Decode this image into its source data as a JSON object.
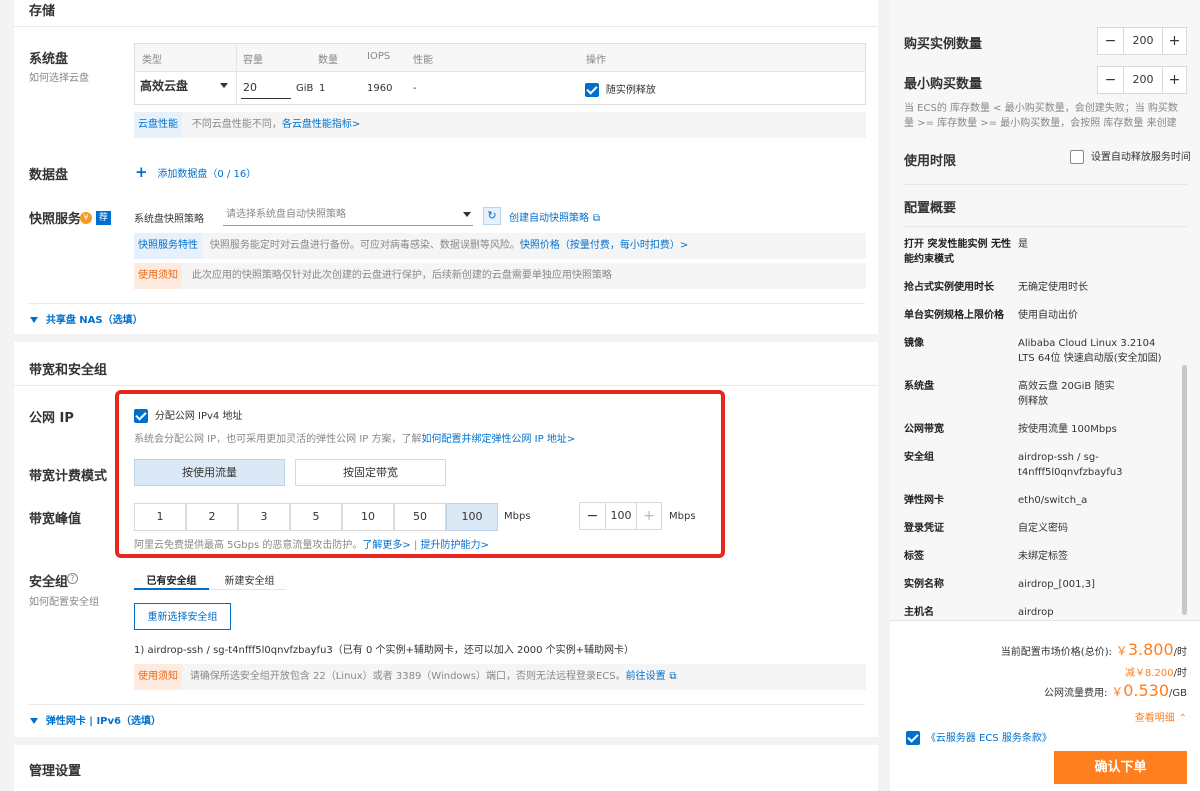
{
  "storage": {
    "section_title": "存储",
    "system_disk_label": "系统盘",
    "system_disk_help": "如何选择云盘",
    "table_headers": [
      "类型",
      "容量",
      "数量",
      "IOPS",
      "性能",
      "操作"
    ],
    "disk_type": "高效云盘",
    "capacity_value": "20",
    "capacity_unit": "GiB",
    "quantity": "1",
    "iops": "1960",
    "performance": "-",
    "release_with_instance": "随实例释放",
    "perf_tag": "云盘性能",
    "perf_text": "不同云盘性能不同，",
    "perf_link": "各云盘性能指标>",
    "data_disk_label": "数据盘",
    "add_data_disk": "添加数据盘（0 / 16）",
    "snapshot_label": "快照服务",
    "snapshot_badge": "荐",
    "snapshot_policy_label": "系统盘快照策略",
    "snapshot_policy_placeholder": "请选择系统盘自动快照策略",
    "create_snapshot_policy": "创建自动快照策略",
    "snapshot_feature_tag": "快照服务特性",
    "snapshot_feature_text": "快照服务能定时对云盘进行备份。可应对病毒感染、数据误删等风险。",
    "snapshot_price_link": "快照价格（按量付费，每小时扣费）>",
    "usage_notice_tag": "使用须知",
    "snapshot_notice_text": "此次应用的快照策略仅针对此次创建的云盘进行保护，后续新创建的云盘需要单独应用快照策略",
    "nas_toggle": "共享盘 NAS（选填）"
  },
  "network": {
    "section_title": "带宽和安全组",
    "public_ip_label": "公网 IP",
    "assign_ipv4": "分配公网 IPv4 地址",
    "ip_desc": "系统会分配公网 IP，也可采用更加灵活的弹性公网 IP 方案，了解",
    "ip_link": "如何配置并绑定弹性公网 IP 地址>",
    "billing_label": "带宽计费模式",
    "billing_options": [
      "按使用流量",
      "按固定带宽"
    ],
    "billing_selected": "按使用流量",
    "peak_label": "带宽峰值",
    "bandwidth_options": [
      "1",
      "2",
      "3",
      "5",
      "10",
      "50",
      "100"
    ],
    "bandwidth_selected": "100",
    "unit": "Mbps",
    "bandwidth_stepper_value": "100",
    "ddos_text": "阿里云免费提供最高 5Gbps 的恶意流量攻击防护。",
    "learn_more": "了解更多>",
    "separator": "|",
    "improve_protection": "提升防护能力>",
    "sg_label": "安全组",
    "sg_help": "如何配置安全组",
    "sg_tabs": [
      "已有安全组",
      "新建安全组"
    ],
    "reselect_sg": "重新选择安全组",
    "sg_line": "1) airdrop-ssh / sg-t4nfff5l0qnvfzbayfu3（已有 0 个实例+辅助网卡，还可以加入 2000 个实例+辅助网卡）",
    "sg_notice_tag": "使用须知",
    "sg_notice_text": "请确保所选安全组开放包含 22（Linux）或者 3389（Windows）端口，否则无法远程登录ECS。",
    "goto_settings": "前往设置",
    "eni_toggle": "弹性网卡 | IPv6（选填）"
  },
  "management": {
    "section_title": "管理设置"
  },
  "sidebar": {
    "buy_count_label": "购买实例数量",
    "buy_count_value": "200",
    "min_buy_label": "最小购买数量",
    "min_buy_value": "200",
    "stock_note": "当 ECS的 库存数量 < 最小购买数量，会创建失败；当 购买数量 >= 库存数量 >= 最小购买数量，会按照 库存数量 来创建",
    "duration_label": "使用时限",
    "auto_release": "设置自动释放服务时间",
    "summary_title": "配置概要",
    "summary": [
      {
        "k": "打开 突发性能实例 无性能约束模式",
        "v": "是"
      },
      {
        "k": "抢占式实例使用时长",
        "v": "无确定使用时长"
      },
      {
        "k": "单台实例规格上限价格",
        "v": "使用自动出价"
      },
      {
        "k": "镜像",
        "v": "Alibaba Cloud Linux 3.2104 LTS 64位 快速启动版(安全加固)"
      },
      {
        "k": "系统盘",
        "v": "高效云盘 20GiB 随实例释放"
      },
      {
        "k": "公网带宽",
        "v": "按使用流量 100Mbps"
      },
      {
        "k": "安全组",
        "v": "airdrop-ssh / sg-t4nfff5l0qnvfzbayfu3"
      },
      {
        "k": "弹性网卡",
        "v": "eth0/switch_a"
      },
      {
        "k": "登录凭证",
        "v": "自定义密码"
      },
      {
        "k": "标签",
        "v": "未绑定标签"
      },
      {
        "k": "实例名称",
        "v": "airdrop_[001,3]"
      },
      {
        "k": "主机名",
        "v": "airdrop"
      }
    ],
    "price_label": "当前配置市场价格(总价):",
    "price_currency": "￥",
    "price_value": "3.800",
    "price_unit": "/时",
    "discount": "减￥8.200",
    "discount_unit": "/时",
    "traffic_label": "公网流量费用:",
    "traffic_currency": "￥",
    "traffic_value": "0.530",
    "traffic_unit": "/GB",
    "view_detail": "查看明细",
    "terms": "《云服务器 ECS 服务条款》",
    "confirm": "确认下单"
  },
  "colors": {
    "accent": "#0070cc",
    "orange": "#ff7f1e",
    "highlight": "#e8261f"
  }
}
